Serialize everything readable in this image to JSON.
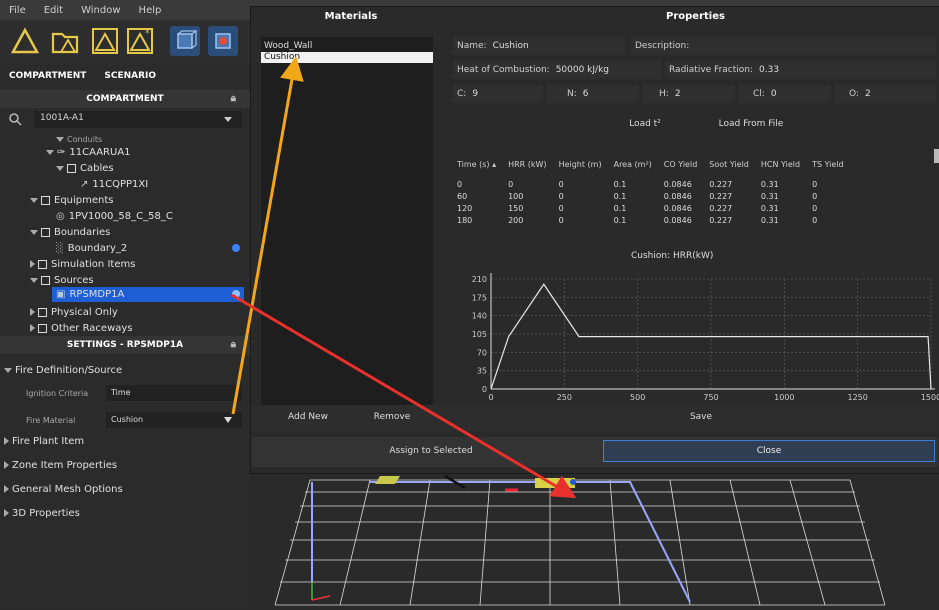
{
  "menu": [
    "File",
    "Edit",
    "Window",
    "Help"
  ],
  "left": {
    "tabs": [
      "COMPARTMENT",
      "SCENARIO"
    ],
    "compartment_header": "COMPARTMENT",
    "compartment_select": "1001A-A1",
    "tree": {
      "conduits": "Conduits",
      "raceway": "11CAARUA1",
      "cables": "Cables",
      "cable": "11CQPP1XI",
      "equipments": "Equipments",
      "equipment": "1PV1000_58_C_58_C",
      "boundaries": "Boundaries",
      "boundary": "Boundary_2",
      "simulation_items": "Simulation Items",
      "sources": "Sources",
      "source": "RPSMDP1A",
      "physical_only": "Physical Only",
      "other_raceways": "Other Raceways"
    },
    "settings_header": "SETTINGS - RPSMDP1A",
    "fire_definition": "Fire Definition/Source",
    "ignition_label": "Ignition Criteria",
    "ignition_value": "Time",
    "fire_material_label": "Fire Material",
    "fire_material_value": "Cushion",
    "sections": [
      "Fire Plant Item",
      "Zone Item Properties",
      "General Mesh Options",
      "3D Properties"
    ]
  },
  "dialog": {
    "materials_title": "Materials",
    "properties_title": "Properties",
    "materials": [
      "Wood_Wall",
      "Cushion"
    ],
    "name_label": "Name:",
    "name_value": "Cushion",
    "description_label": "Description:",
    "heat_label": "Heat of Combustion:",
    "heat_value": "50000 kJ/kg",
    "radiative_label": "Radiative Fraction:",
    "radiative_value": "0.33",
    "c_label": "C:",
    "c_value": "9",
    "n_label": "N:",
    "n_value": "6",
    "h_label": "H:",
    "h_value": "2",
    "cl_label": "Cl:",
    "cl_value": "0",
    "o_label": "O:",
    "o_value": "2",
    "load_t2": "Load t²",
    "load_file": "Load From File",
    "columns": [
      "Time (s)",
      "HRR (kW)",
      "Height (m)",
      "Area (m²)",
      "CO Yield",
      "Soot Yield",
      "HCN Yield",
      "TS Yield"
    ],
    "rows": [
      [
        "0",
        "0",
        "0",
        "0.1",
        "0.0846",
        "0.227",
        "0.31",
        "0"
      ],
      [
        "60",
        "100",
        "0",
        "0.1",
        "0.0846",
        "0.227",
        "0.31",
        "0"
      ],
      [
        "120",
        "150",
        "0",
        "0.1",
        "0.0846",
        "0.227",
        "0.31",
        "0"
      ],
      [
        "180",
        "200",
        "0",
        "0.1",
        "0.0846",
        "0.227",
        "0.31",
        "0"
      ]
    ],
    "add_new": "Add New",
    "remove": "Remove",
    "save": "Save",
    "assign": "Assign to Selected",
    "close": "Close"
  },
  "chart_data": {
    "type": "line",
    "title": "Cushion: HRR(kW)",
    "x": [
      0,
      60,
      120,
      180,
      300,
      1490,
      1500
    ],
    "y": [
      0,
      100,
      150,
      200,
      100,
      100,
      0
    ],
    "xlim": [
      0,
      1500
    ],
    "ylim": [
      0,
      210
    ],
    "xticks": [
      0,
      250,
      500,
      750,
      1000,
      1250,
      1500
    ],
    "yticks": [
      0,
      35,
      70,
      105,
      140,
      175,
      210
    ],
    "grid": true
  }
}
